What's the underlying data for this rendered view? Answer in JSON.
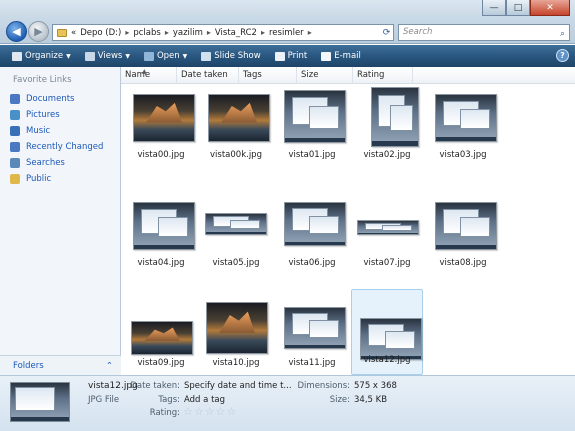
{
  "window": {
    "minimize_glyph": "—",
    "maximize_glyph": "□",
    "close_glyph": "✕"
  },
  "address": {
    "overflow": "«",
    "crumbs": [
      "Depo (D:)",
      "pclabs",
      "yazilim",
      "Vista_RC2",
      "resimler"
    ]
  },
  "search": {
    "placeholder": "Search"
  },
  "toolbar": {
    "organize": "Organize",
    "views": "Views",
    "open": "Open",
    "slideshow": "Slide Show",
    "print": "Print",
    "email": "E-mail",
    "help": "?"
  },
  "nav": {
    "heading": "Favorite Links",
    "items": [
      {
        "label": "Documents",
        "color": "#4a78c2"
      },
      {
        "label": "Pictures",
        "color": "#4a90c8"
      },
      {
        "label": "Music",
        "color": "#3a70b8"
      },
      {
        "label": "Recently Changed",
        "color": "#4a78c2"
      },
      {
        "label": "Searches",
        "color": "#5a88b8"
      },
      {
        "label": "Public",
        "color": "#e0b84a"
      }
    ],
    "folders_label": "Folders",
    "folders_chevron": "⌃"
  },
  "columns": [
    "Name",
    "Date taken",
    "Tags",
    "Size",
    "Rating"
  ],
  "files": [
    {
      "name": "vista00.jpg",
      "art": "mountain"
    },
    {
      "name": "vista00k.jpg",
      "art": "mountain"
    },
    {
      "name": "vista01.jpg",
      "art": "desktop"
    },
    {
      "name": "vista02.jpg",
      "art": "desktop"
    },
    {
      "name": "vista03.jpg",
      "art": "desktop"
    },
    {
      "name": "vista04.jpg",
      "art": "desktop"
    },
    {
      "name": "vista05.jpg",
      "art": "desktop"
    },
    {
      "name": "vista06.jpg",
      "art": "desktop"
    },
    {
      "name": "vista07.jpg",
      "art": "desktop"
    },
    {
      "name": "vista08.jpg",
      "art": "desktop"
    },
    {
      "name": "vista09.jpg",
      "art": "mountain"
    },
    {
      "name": "vista10.jpg",
      "art": "mountain"
    },
    {
      "name": "vista11.jpg",
      "art": "desktop"
    },
    {
      "name": "vista12.jpg",
      "art": "desktop",
      "selected": true
    }
  ],
  "details": {
    "filename": "vista12.jpg",
    "filetype": "JPG File",
    "date_label": "Date taken:",
    "date_value": "Specify date and time t...",
    "tags_label": "Tags:",
    "tags_value": "Add a tag",
    "rating_label": "Rating:",
    "rating_stars": 0,
    "dimensions_label": "Dimensions:",
    "dimensions_value": "575 x 368",
    "size_label": "Size:",
    "size_value": "34,5 KB"
  }
}
